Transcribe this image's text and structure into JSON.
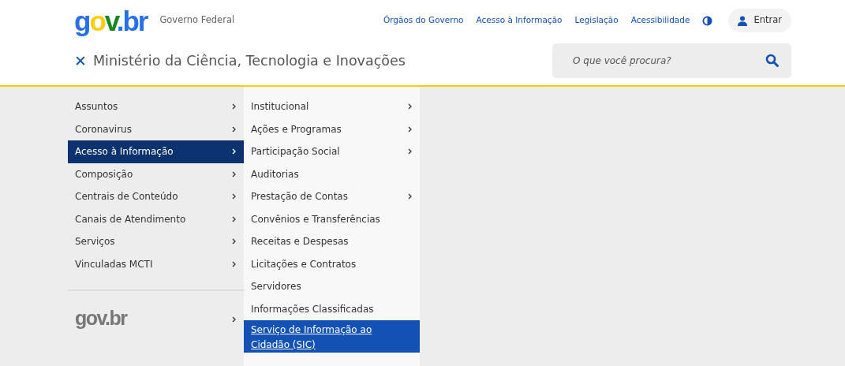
{
  "header": {
    "logo": "gov.br",
    "subtitle": "Governo Federal",
    "links": [
      "Órgãos do Governo",
      "Acesso à Informação",
      "Legislação",
      "Acessibilidade"
    ],
    "login": "Entrar",
    "close_symbol": "✕",
    "site_title": "Ministério da Ciência, Tecnologia e Inovações",
    "search": {
      "placeholder": "O que você procura?"
    }
  },
  "menu": [
    {
      "label": "Assuntos",
      "has_submenu": true,
      "selected": false
    },
    {
      "label": "Coronavirus",
      "has_submenu": true,
      "selected": false
    },
    {
      "label": "Acesso à Informação",
      "has_submenu": true,
      "selected": true
    },
    {
      "label": "Composição",
      "has_submenu": true,
      "selected": false
    },
    {
      "label": "Centrais de Conteúdo",
      "has_submenu": true,
      "selected": false
    },
    {
      "label": "Canais de Atendimento",
      "has_submenu": true,
      "selected": false
    },
    {
      "label": "Serviços",
      "has_submenu": true,
      "selected": false
    },
    {
      "label": "Vinculadas MCTI",
      "has_submenu": true,
      "selected": false
    }
  ],
  "menu_footer": {
    "logo": "gov.br",
    "has_submenu": true
  },
  "submenu": [
    {
      "label": "Institucional",
      "has_submenu": true,
      "selected": false
    },
    {
      "label": "Ações e Programas",
      "has_submenu": true,
      "selected": false
    },
    {
      "label": "Participação Social",
      "has_submenu": true,
      "selected": false
    },
    {
      "label": "Auditorias",
      "has_submenu": false,
      "selected": false
    },
    {
      "label": "Prestação de Contas",
      "has_submenu": true,
      "selected": false
    },
    {
      "label": "Convênios e Transferências",
      "has_submenu": false,
      "selected": false
    },
    {
      "label": "Receitas e Despesas",
      "has_submenu": false,
      "selected": false
    },
    {
      "label": "Licitações e Contratos",
      "has_submenu": false,
      "selected": false
    },
    {
      "label": "Servidores",
      "has_submenu": false,
      "selected": false
    },
    {
      "label": "Informações Classificadas",
      "has_submenu": false,
      "selected": false
    },
    {
      "label": "Serviço de Informação ao Cidadão (SIC)",
      "has_submenu": false,
      "selected": true
    }
  ]
}
